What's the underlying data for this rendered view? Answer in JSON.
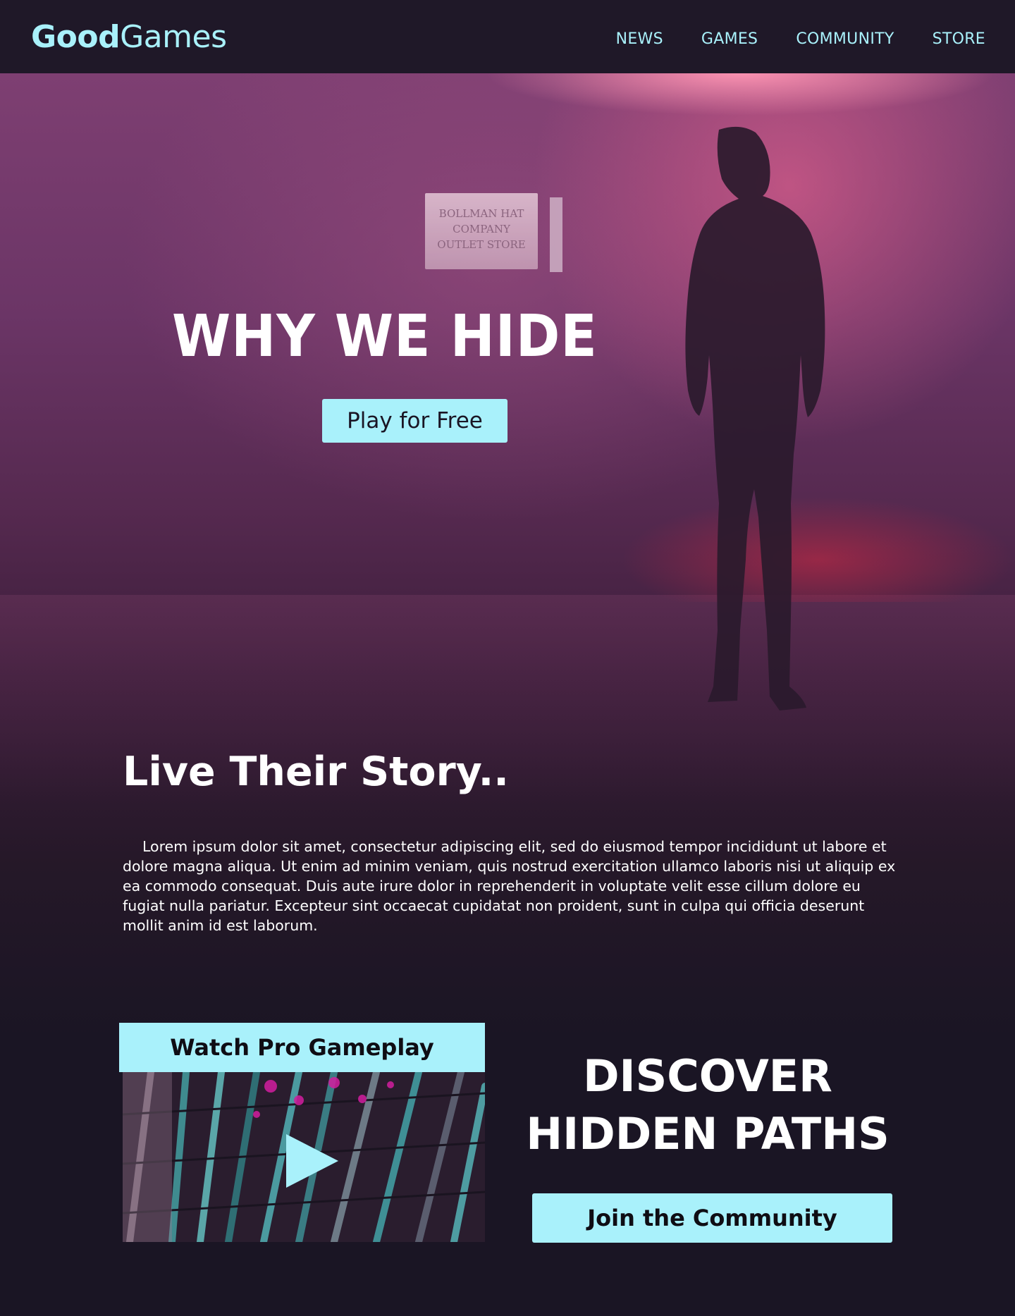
{
  "nav": {
    "logo_bold": "Good",
    "logo_regular": "Games",
    "links": [
      "NEWS",
      "GAMES",
      "COMMUNITY",
      "STORE"
    ]
  },
  "hero": {
    "title": "WHY WE HIDE",
    "cta_label": "Play for Free",
    "sign_text": [
      "BOLLMAN HAT",
      "COMPANY",
      "OUTLET STORE"
    ]
  },
  "story": {
    "title": "Live Their Story..",
    "body": "Lorem ipsum dolor sit amet, consectetur adipiscing elit, sed do eiusmod tempor incididunt ut labore et dolore magna aliqua. Ut enim ad minim veniam, quis nostrud exercitation ullamco laboris nisi ut aliquip ex ea commodo consequat. Duis aute irure dolor in reprehenderit in voluptate velit esse cillum dolore eu fugiat nulla pariatur. Excepteur sint occaecat cupidatat non proident, sunt in culpa qui officia deserunt mollit anim id est laborum."
  },
  "watch": {
    "title": "Watch Pro Gameplay",
    "play_icon": "play-icon"
  },
  "discover": {
    "line1": "DISCOVER",
    "line2": "HIDDEN PATHS",
    "cta_label": "Join the Community"
  },
  "colors": {
    "accent": "#a9f1fb",
    "background": "#1a1524",
    "nav_background": "#1f1828"
  }
}
